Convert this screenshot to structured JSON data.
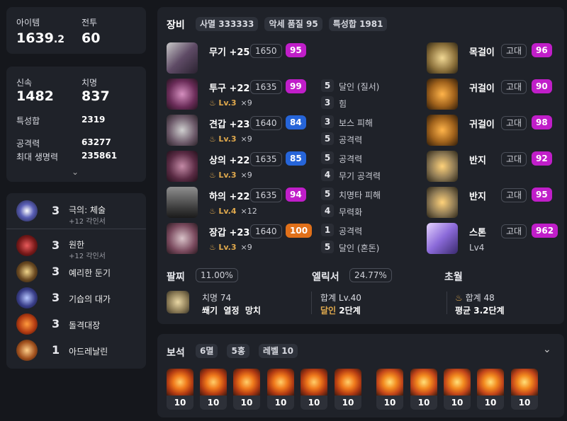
{
  "summary": {
    "item_label": "아이템",
    "item_value": "1639",
    "item_decimal": ".2",
    "combat_label": "전투",
    "combat_value": "60"
  },
  "stats": {
    "swiftness_label": "신속",
    "swiftness_value": "1482",
    "crit_label": "치명",
    "crit_value": "837",
    "special_total_label": "특성합",
    "special_total_value": "2319",
    "attack_label": "공격력",
    "attack_value": "63277",
    "hp_label": "최대 생명력",
    "hp_value": "235861",
    "expand_icon": "chevron-down"
  },
  "engravings": [
    {
      "level": "3",
      "name": "극의: 체술",
      "sub": "+12 각인서",
      "icon": "engraving-1"
    },
    {
      "level": "3",
      "name": "원한",
      "sub": "+12 각인서",
      "icon": "engraving-2"
    },
    {
      "level": "3",
      "name": "예리한 둔기",
      "sub": "",
      "icon": "engraving-3"
    },
    {
      "level": "3",
      "name": "기습의 대가",
      "sub": "",
      "icon": "engraving-4"
    },
    {
      "level": "3",
      "name": "돌격대장",
      "sub": "",
      "icon": "engraving-5"
    },
    {
      "level": "1",
      "name": "아드레날린",
      "sub": "",
      "icon": "engraving-6"
    }
  ],
  "equipment": {
    "title": "장비",
    "tags": [
      "사멸 333333",
      "악세 품질 95",
      "특성합 1981"
    ],
    "items": [
      {
        "name": "무기 +25",
        "ilvl": "1650",
        "quality": "95",
        "qcolor": "purple",
        "sub_lv": "",
        "sub_x": ""
      },
      {
        "name": "투구 +22",
        "ilvl": "1635",
        "quality": "99",
        "qcolor": "purple",
        "sub_lv": "Lv.3",
        "sub_x": "×9"
      },
      {
        "name": "견갑 +23",
        "ilvl": "1640",
        "quality": "84",
        "qcolor": "blue",
        "sub_lv": "Lv.3",
        "sub_x": "×9"
      },
      {
        "name": "상의 +22",
        "ilvl": "1635",
        "quality": "85",
        "qcolor": "blue",
        "sub_lv": "Lv.3",
        "sub_x": "×9"
      },
      {
        "name": "하의 +22",
        "ilvl": "1635",
        "quality": "94",
        "qcolor": "purple",
        "sub_lv": "Lv.4",
        "sub_x": "×12"
      },
      {
        "name": "장갑 +23",
        "ilvl": "1640",
        "quality": "100",
        "qcolor": "orange",
        "sub_lv": "Lv.3",
        "sub_x": "×9"
      }
    ],
    "engrave_effects": [
      {
        "n": "5",
        "t": "달인 (질서)"
      },
      {
        "n": "3",
        "t": "힘"
      },
      {
        "n": "3",
        "t": "보스 피해"
      },
      {
        "n": "5",
        "t": "공격력"
      },
      {
        "n": "5",
        "t": "공격력"
      },
      {
        "n": "4",
        "t": "무기 공격력"
      },
      {
        "n": "5",
        "t": "치명타 피해"
      },
      {
        "n": "4",
        "t": "무력화"
      },
      {
        "n": "1",
        "t": "공격력"
      },
      {
        "n": "5",
        "t": "달인 (혼돈)"
      }
    ],
    "accessories": [
      {
        "name": "목걸이",
        "grade": "고대",
        "quality": "96"
      },
      {
        "name": "귀걸이",
        "grade": "고대",
        "quality": "90"
      },
      {
        "name": "귀걸이",
        "grade": "고대",
        "quality": "98"
      },
      {
        "name": "반지",
        "grade": "고대",
        "quality": "92"
      },
      {
        "name": "반지",
        "grade": "고대",
        "quality": "95"
      },
      {
        "name": "스톤",
        "grade": "고대",
        "quality": "962",
        "sub": "Lv4"
      }
    ]
  },
  "bracelet": {
    "title": "팔찌",
    "pct": "11.00%",
    "line1": "치명 74",
    "line2": "쐐기  열정  망치"
  },
  "elixir": {
    "title": "엘릭서",
    "pct": "24.77%",
    "line1": "합계 Lv.40",
    "line2_a": "달인",
    "line2_b": "2단계"
  },
  "transcend": {
    "title": "초월",
    "line1": "합계 48",
    "line2": "평균 3.2단계"
  },
  "gems": {
    "title": "보석",
    "tags": [
      "6멸",
      "5홍",
      "레벨 10"
    ],
    "levels": [
      "10",
      "10",
      "10",
      "10",
      "10",
      "10",
      "10",
      "10",
      "10",
      "10",
      "10"
    ],
    "collapse_icon": "chevron-down"
  },
  "colors": {
    "purple": "#c01ec9",
    "blue": "#2665d9",
    "orange": "#e0701a",
    "gold": "#e0a94d"
  }
}
